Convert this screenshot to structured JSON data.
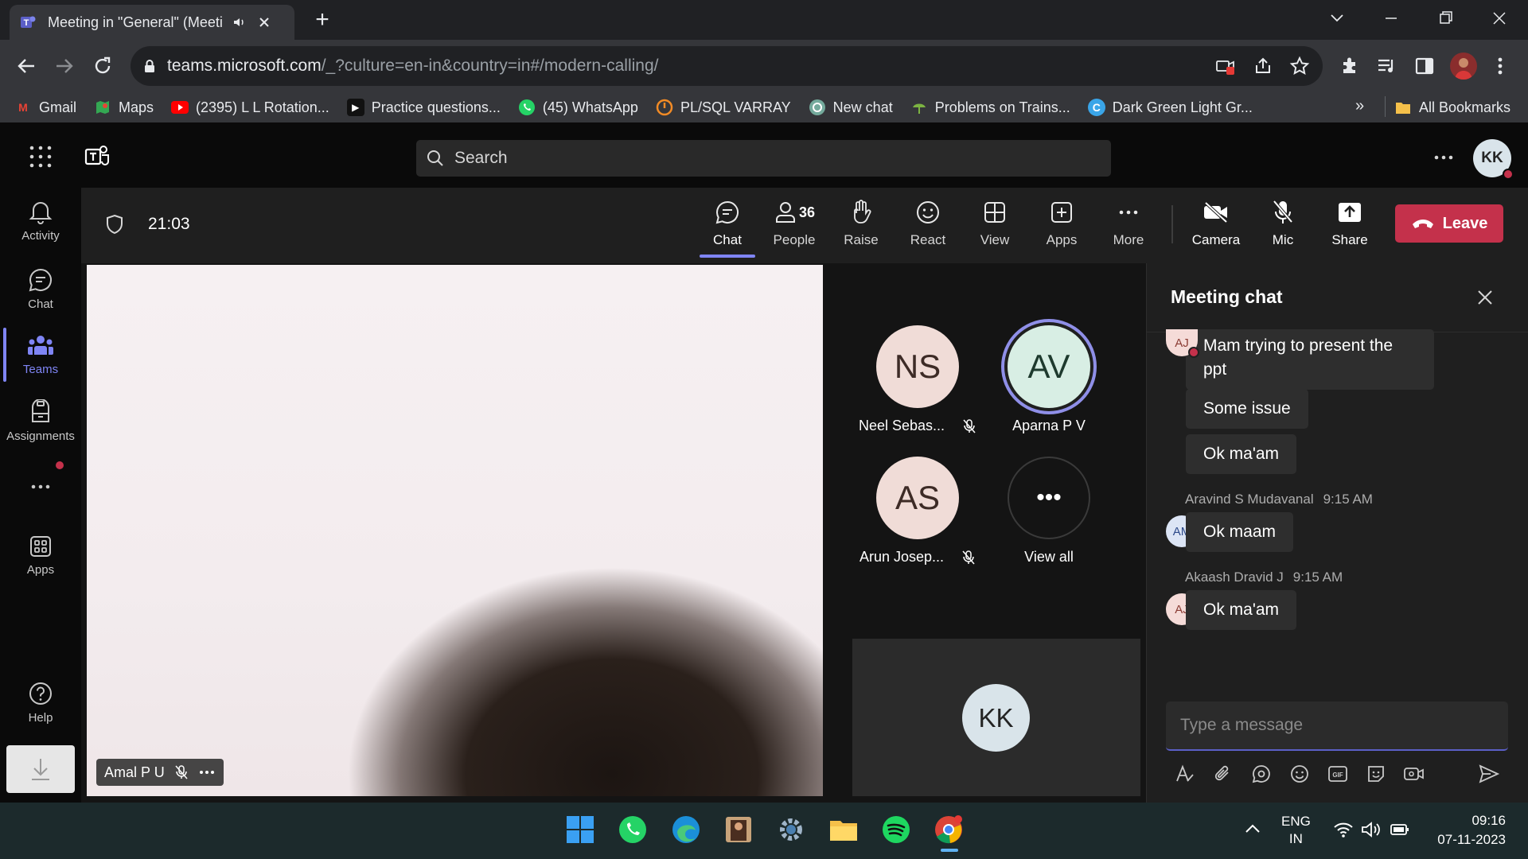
{
  "browser": {
    "tab_title": "Meeting in \"General\" (Meeti",
    "url_host": "teams.microsoft.com",
    "url_path": "/_?culture=en-in&country=in#/modern-calling/",
    "bookmarks": [
      {
        "label": "Gmail",
        "icon": "gmail-icon",
        "color": "#ea4335"
      },
      {
        "label": "Maps",
        "icon": "maps-icon",
        "color": "#34a853"
      },
      {
        "label": "(2395) L L Rotation...",
        "icon": "youtube-icon",
        "color": "#ff0000"
      },
      {
        "label": "Practice questions...",
        "icon": "practice-icon",
        "color": "#111111"
      },
      {
        "label": "(45) WhatsApp",
        "icon": "whatsapp-icon",
        "color": "#25d366"
      },
      {
        "label": "PL/SQL VARRAY",
        "icon": "plsql-icon",
        "color": "#f28b25"
      },
      {
        "label": "New chat",
        "icon": "chatgpt-icon",
        "color": "#74aa9c"
      },
      {
        "label": "Problems on Trains...",
        "icon": "trains-icon",
        "color": "#7cb342"
      },
      {
        "label": "Dark Green Light Gr...",
        "icon": "canva-icon",
        "color": "#3aa5e8"
      }
    ],
    "all_bookmarks": "All Bookmarks"
  },
  "teams": {
    "search_placeholder": "Search",
    "user_initials": "KK",
    "rail": [
      {
        "label": "Activity",
        "icon": "bell-icon"
      },
      {
        "label": "Chat",
        "icon": "chat-icon"
      },
      {
        "label": "Teams",
        "icon": "teams-icon"
      },
      {
        "label": "Assignments",
        "icon": "assignments-icon"
      },
      {
        "label": "Apps",
        "icon": "apps-icon"
      },
      {
        "label": "Help",
        "icon": "help-icon"
      }
    ]
  },
  "meeting": {
    "timer": "21:03",
    "controls": {
      "chat": "Chat",
      "people": "People",
      "people_count": "36",
      "raise": "Raise",
      "react": "React",
      "view": "View",
      "apps": "Apps",
      "more": "More",
      "camera": "Camera",
      "mic": "Mic",
      "share": "Share",
      "leave": "Leave"
    },
    "video_participant": "Amal P U",
    "participants": [
      {
        "initials": "NS",
        "name": "Neel Sebas...",
        "muted": true
      },
      {
        "initials": "AV",
        "name": "Aparna P V",
        "muted": false,
        "speaking": true
      },
      {
        "initials": "AS",
        "name": "Arun Josep...",
        "muted": true
      }
    ],
    "view_all": "View all",
    "view_all_glyph": "•••",
    "self_initials": "KK"
  },
  "chat": {
    "title": "Meeting chat",
    "messages": [
      {
        "sender_initials": "AJ",
        "text": "Mam trying to present the ppt"
      },
      {
        "text": "Some issue"
      },
      {
        "text": "Ok ma'am"
      },
      {
        "sender": "Aravind S Mudavanal",
        "time": "9:15 AM",
        "sender_initials": "AM",
        "text": "Ok maam"
      },
      {
        "sender": "Akaash Dravid J",
        "time": "9:15 AM",
        "sender_initials": "AJ",
        "text": "Ok ma'am"
      }
    ],
    "msg1_line1": "Mam trying to present the",
    "msg1_line2": "ppt",
    "compose_placeholder": "Type a message"
  },
  "taskbar": {
    "lang_line1": "ENG",
    "lang_line2": "IN",
    "time": "09:16",
    "date": "07-11-2023"
  },
  "colors": {
    "accent": "#7f85f5",
    "leave": "#c4314b",
    "teams_bg": "#0a0a0a"
  }
}
